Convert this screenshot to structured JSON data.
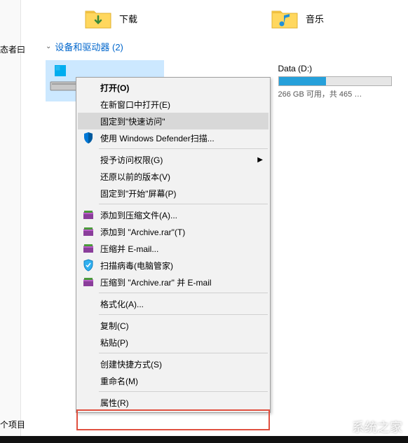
{
  "left_partial_label": "态者曰",
  "bottom_partial_label": "个项目",
  "folders": {
    "downloads": {
      "label": "下载"
    },
    "music": {
      "label": "音乐"
    }
  },
  "group_header": "设备和驱动器 (2)",
  "drives": {
    "d": {
      "name": "Data (D:)",
      "status": "266 GB 可用，共 465 …",
      "fill_percent": 42
    }
  },
  "context_menu": {
    "open": "打开(O)",
    "open_new_window": "在新窗口中打开(E)",
    "pin_quick_access": "固定到\"快速访问\"",
    "defender_scan": "使用 Windows Defender扫描...",
    "grant_access": "授予访问权限(G)",
    "restore_previous": "还原以前的版本(V)",
    "pin_start": "固定到\"开始\"屏幕(P)",
    "add_to_archive": "添加到压缩文件(A)...",
    "add_to_archive_rar": "添加到 \"Archive.rar\"(T)",
    "compress_email": "压缩并 E-mail...",
    "scan_virus": "扫描病毒(电脑管家)",
    "compress_rar_email": "压缩到 \"Archive.rar\" 并 E-mail",
    "format": "格式化(A)...",
    "copy": "复制(C)",
    "paste": "粘贴(P)",
    "create_shortcut": "创建快捷方式(S)",
    "rename": "重命名(M)",
    "properties": "属性(R)"
  },
  "watermark": "系统之家"
}
